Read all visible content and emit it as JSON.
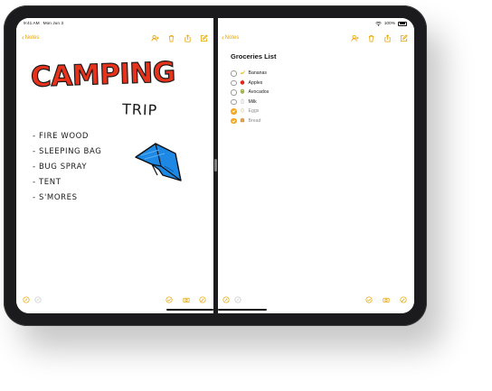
{
  "status_bar": {
    "time": "9:41 AM",
    "date": "Mon Jun 3",
    "battery": "100%"
  },
  "left_pane": {
    "back_label": "Notes",
    "heading": "CAMPING",
    "subheading": "TRIP",
    "items": [
      "- FIRE WOOD",
      "- SLEEPING BAG",
      "- BUG SPRAY",
      "- TENT",
      "- S'MORES"
    ]
  },
  "right_pane": {
    "back_label": "Notes",
    "title": "Groceries List",
    "items": [
      {
        "label": "Bananas",
        "emoji": "banana",
        "checked": false
      },
      {
        "label": "Apples",
        "emoji": "apple",
        "checked": false
      },
      {
        "label": "Avocados",
        "emoji": "avocado",
        "checked": false
      },
      {
        "label": "Milk",
        "emoji": "milk",
        "checked": false
      },
      {
        "label": "Eggs",
        "emoji": "egg",
        "checked": true
      },
      {
        "label": "Bread",
        "emoji": "bread",
        "checked": true
      }
    ]
  },
  "colors": {
    "accent": "#e7a400",
    "heading_red": "#e8331c",
    "tent_blue": "#1e88e5",
    "check_orange": "#f5a623"
  },
  "icons": {
    "toolbar": [
      "add-person-icon",
      "trash-icon",
      "share-icon",
      "compose-icon"
    ],
    "bottom": [
      "markup-icon",
      "checklist-icon",
      "camera-icon",
      "pen-icon"
    ]
  }
}
